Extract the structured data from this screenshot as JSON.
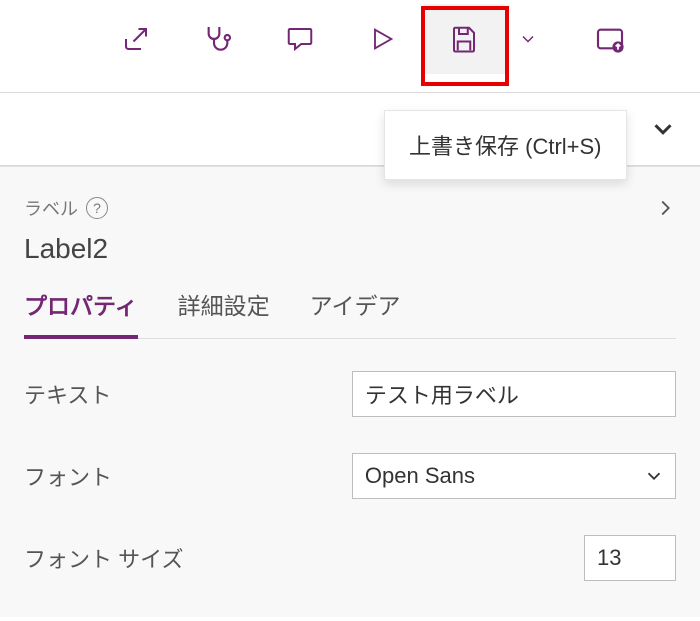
{
  "toolbar": {
    "icons": {
      "share": "share-icon",
      "diagnostics": "stethoscope-icon",
      "comments": "comment-icon",
      "play": "play-icon",
      "save": "save-icon",
      "more": "chevron-down-icon",
      "publish": "upload-icon"
    }
  },
  "tooltip": {
    "save": "上書き保存 (Ctrl+S)"
  },
  "panel": {
    "type_label": "ラベル",
    "control_name": "Label2",
    "tabs": {
      "properties": "プロパティ",
      "advanced": "詳細設定",
      "ideas": "アイデア"
    },
    "props": {
      "text_label": "テキスト",
      "text_value": "テスト用ラベル",
      "font_label": "フォント",
      "font_value": "Open Sans",
      "fontsize_label": "フォント サイズ",
      "fontsize_value": "13"
    }
  },
  "colors": {
    "accent": "#742774",
    "highlight_border": "#e60000"
  }
}
